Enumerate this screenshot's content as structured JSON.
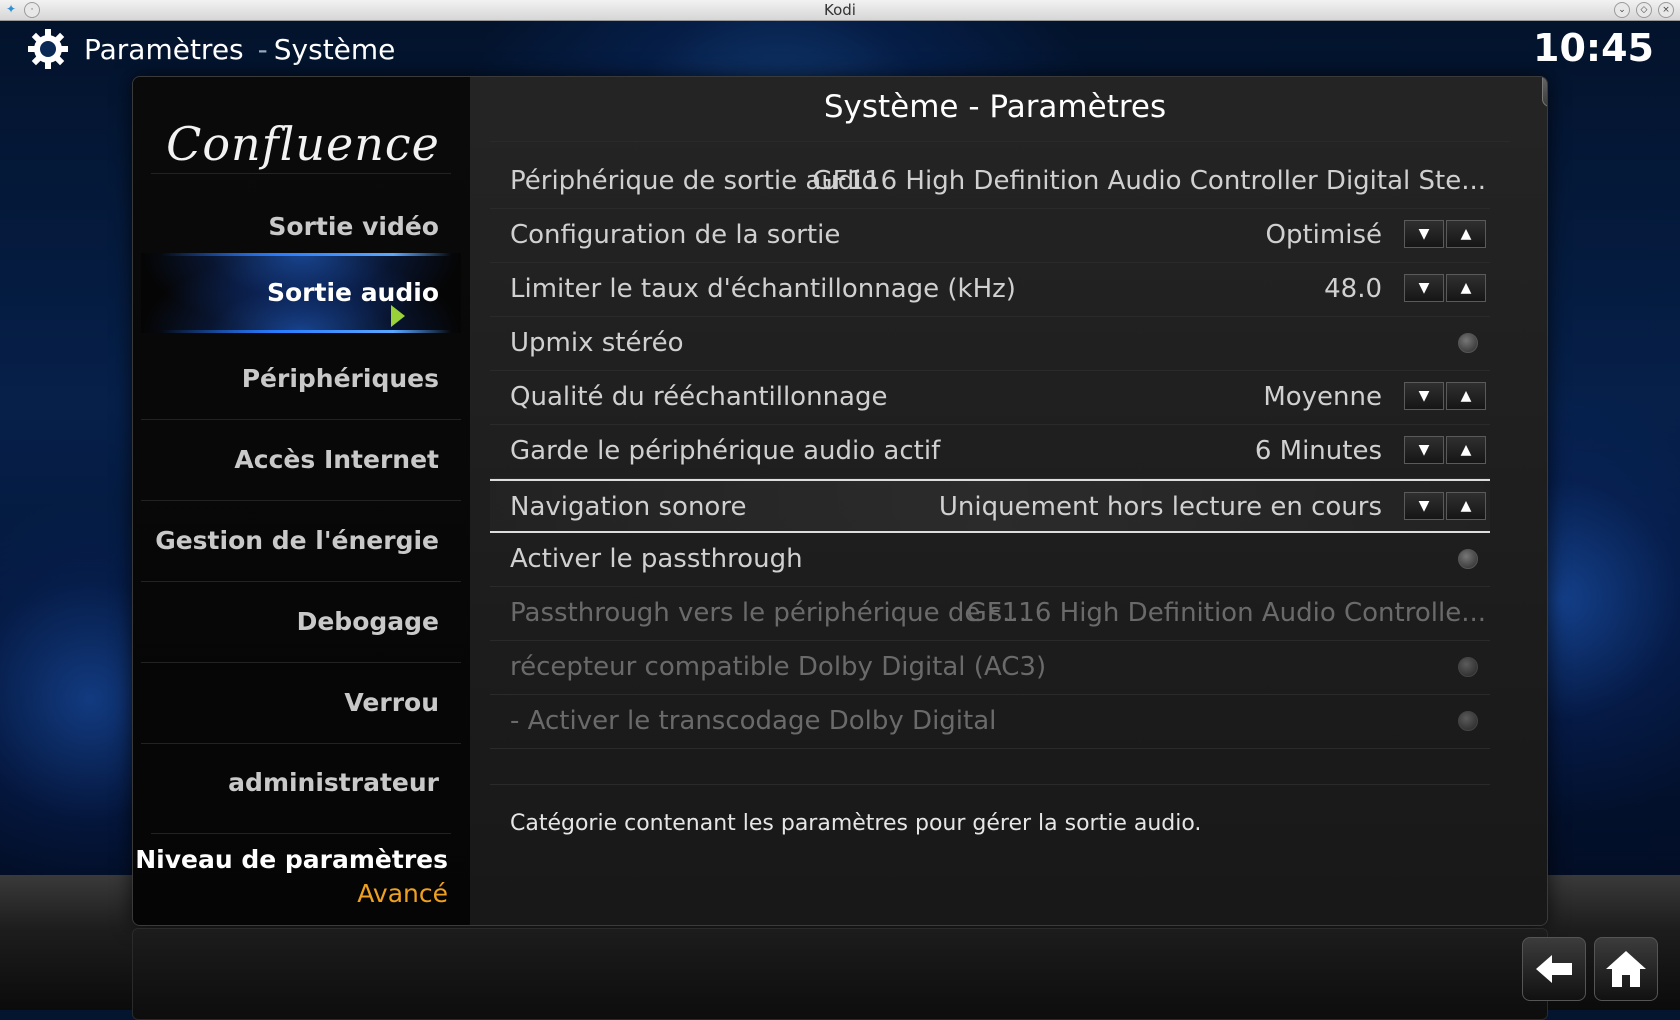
{
  "window": {
    "title": "Kodi"
  },
  "header": {
    "title": "Paramètres",
    "separator": "-",
    "subtitle": "Système",
    "clock": "10:45"
  },
  "sidebar": {
    "logo": "Confluence",
    "items": [
      {
        "label": "Sortie vidéo",
        "active": false
      },
      {
        "label": "Sortie audio",
        "active": true
      },
      {
        "label": "Périphériques",
        "active": false
      },
      {
        "label": "Accès Internet",
        "active": false
      },
      {
        "label": "Gestion de l'énergie",
        "active": false
      },
      {
        "label": "Debogage",
        "active": false
      },
      {
        "label": "Verrou administrateur",
        "active": false
      }
    ],
    "level_label": "Niveau de paramètres",
    "level_value": "Avancé"
  },
  "content": {
    "title": "Système - Paramètres",
    "close_label": "✕",
    "rows": [
      {
        "label": "Périphérique de sortie audio",
        "value": "GF116 High Definition Audio Controller Digital Ste...",
        "control": "none",
        "enabled": true
      },
      {
        "label": "Configuration de la sortie",
        "value": "Optimisé",
        "control": "spin",
        "enabled": true
      },
      {
        "label": "Limiter le taux d'échantillonnage (kHz)",
        "value": "48.0",
        "control": "spin",
        "enabled": true
      },
      {
        "label": "Upmix stéréo",
        "value": "",
        "control": "radio",
        "enabled": true
      },
      {
        "label": "Qualité du rééchantillonnage",
        "value": "Moyenne",
        "control": "spin",
        "enabled": true
      },
      {
        "label": "Garde le périphérique audio actif",
        "value": "6 Minutes",
        "control": "spin",
        "enabled": true
      },
      {
        "label": "Navigation sonore",
        "value": "Uniquement hors lecture en cours",
        "control": "spin",
        "enabled": true,
        "selected": true
      },
      {
        "label": "Activer le passthrough",
        "value": "",
        "control": "radio",
        "enabled": true
      },
      {
        "label": "Passthrough vers le périphérique de s...",
        "value": "GF116 High Definition Audio Controlle...",
        "control": "none",
        "enabled": false
      },
      {
        "label": "récepteur compatible Dolby Digital (AC3)",
        "value": "",
        "control": "radio",
        "enabled": false
      },
      {
        "label": "- Activer le transcodage Dolby Digital",
        "value": "",
        "control": "radio",
        "enabled": false
      }
    ],
    "description": "Catégorie contenant les paramètres pour gérer la sortie audio."
  },
  "icons": {
    "header": "gear-icon",
    "back": "back-arrow-icon",
    "home": "home-icon"
  },
  "colors": {
    "accent": "#2a7bff",
    "level_value": "#f0a020"
  }
}
